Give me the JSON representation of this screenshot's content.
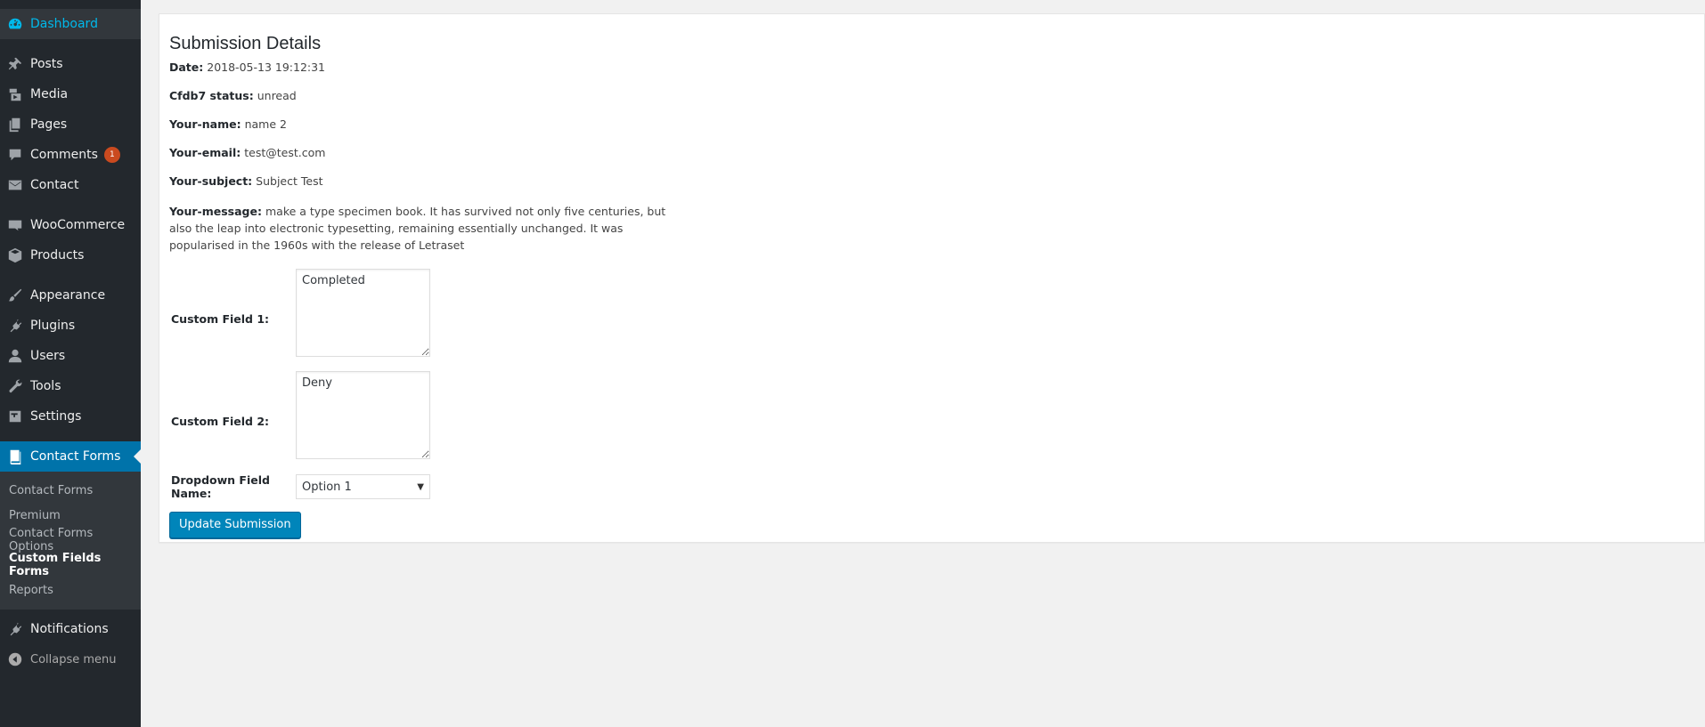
{
  "sidebar": {
    "dashboard": "Dashboard",
    "posts": "Posts",
    "media": "Media",
    "pages": "Pages",
    "comments": "Comments",
    "comments_badge": "1",
    "contact": "Contact",
    "woocommerce": "WooCommerce",
    "products": "Products",
    "appearance": "Appearance",
    "plugins": "Plugins",
    "users": "Users",
    "tools": "Tools",
    "settings": "Settings",
    "contact_forms": "Contact Forms",
    "submenu": [
      "Contact Forms",
      "Premium",
      "Contact Forms Options",
      "Custom Fields Forms",
      "Reports"
    ],
    "notifications": "Notifications",
    "collapse": "Collapse menu"
  },
  "main": {
    "title": "Submission Details",
    "fields": [
      {
        "label": "Date:",
        "value": "2018-05-13 19:12:31"
      },
      {
        "label": "Cfdb7 status:",
        "value": "unread"
      },
      {
        "label": "Your-name:",
        "value": "name 2"
      },
      {
        "label": "Your-email:",
        "value": "test@test.com"
      },
      {
        "label": "Your-subject:",
        "value": "Subject Test"
      },
      {
        "label": "Your-message:",
        "value": "make a type specimen book. It has survived not only five centuries, but also the leap into electronic typesetting, remaining essentially unchanged. It was popularised in the 1960s with the release of Letraset"
      }
    ],
    "custom_field_1_label": "Custom Field 1:",
    "custom_field_1_value": "Completed",
    "custom_field_2_label": "Custom Field 2:",
    "custom_field_2_value": "Deny",
    "dropdown_label": "Dropdown Field Name:",
    "dropdown_value": "Option 1",
    "update_button": "Update Submission"
  },
  "colors": {
    "sidebar_bg": "#23282d",
    "current_menu": "#0073aa",
    "button": "#0085ba",
    "badge": "#ca4a1f"
  }
}
